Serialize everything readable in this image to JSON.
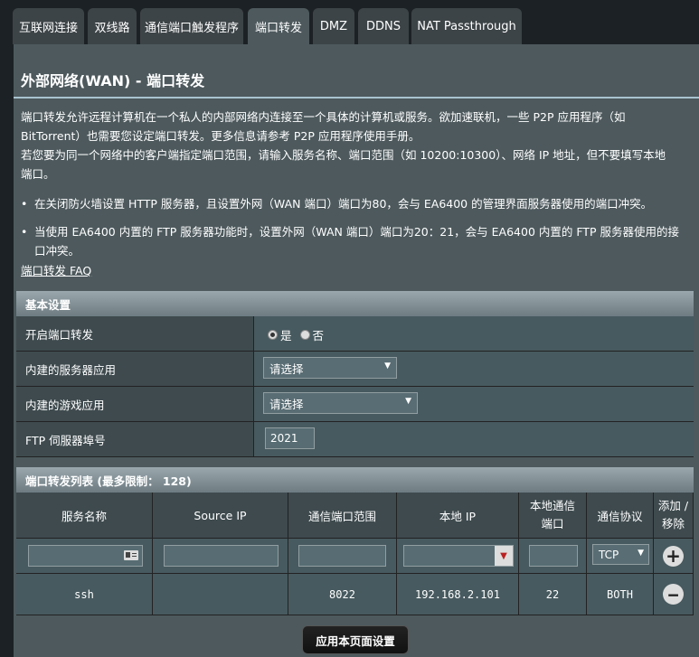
{
  "tabs": [
    "互联网连接",
    "双线路",
    "通信端口触发程序",
    "端口转发",
    "DMZ",
    "DDNS",
    "NAT Passthrough"
  ],
  "active_tab": "端口转发",
  "page_title": "外部网络(WAN) - 端口转发",
  "description": {
    "line1": "端口转发允许远程计算机在一个私人的内部网络内连接至一个具体的计算机或服务。欲加速联机，一些 P2P 应用程序（如",
    "line2": "BitTorrent）也需要您设定端口转发。更多信息请参考 P2P 应用程序使用手册。",
    "line3": "若您要为同一个网络中的客户端指定端口范围，请输入服务名称、端口范围（如 10200:10300）、网络 IP 地址，但不要填写本地",
    "line4": "端口。",
    "bullet1": "在关闭防火墙设置 HTTP 服务器，且设置外网（WAN 端口）端口为80，会与 EA6400 的管理界面服务器使用的端口冲突。",
    "bullet2_line1": "当使用 EA6400 内置的 FTP 服务器功能时，设置外网（WAN 端口）端口为20：21，会与 EA6400 内置的 FTP 服务器使用的接",
    "bullet2_line2": "口冲突。"
  },
  "faq_link": "端口转发 FAQ",
  "basic": {
    "header": "基本设置",
    "enable_label": "开启端口转发",
    "yes": "是",
    "no": "否",
    "enabled": true,
    "server_app_label": "内建的服务器应用",
    "server_app_value": "请选择",
    "game_app_label": "内建的游戏应用",
    "game_app_value": "请选择",
    "ftp_label": "FTP 伺服器埠号",
    "ftp_value": "2021"
  },
  "list": {
    "header": "端口转发列表 (最多限制： 128)",
    "columns": [
      "服务名称",
      "Source IP",
      "通信端口范围",
      "本地 IP",
      "本地通信端口",
      "通信协议",
      "添加 / 移除"
    ],
    "protocol_default": "TCP",
    "rows": [
      {
        "service": "ssh",
        "source_ip": "",
        "port_range": "8022",
        "local_ip": "192.168.2.101",
        "local_port": "22",
        "protocol": "BOTH"
      }
    ]
  },
  "apply_button": "应用本页面设置",
  "icons": {
    "add": "plus-circle-icon",
    "remove": "minus-circle-icon",
    "card": "id-card-icon",
    "dropdown": "triangle-down-icon"
  }
}
